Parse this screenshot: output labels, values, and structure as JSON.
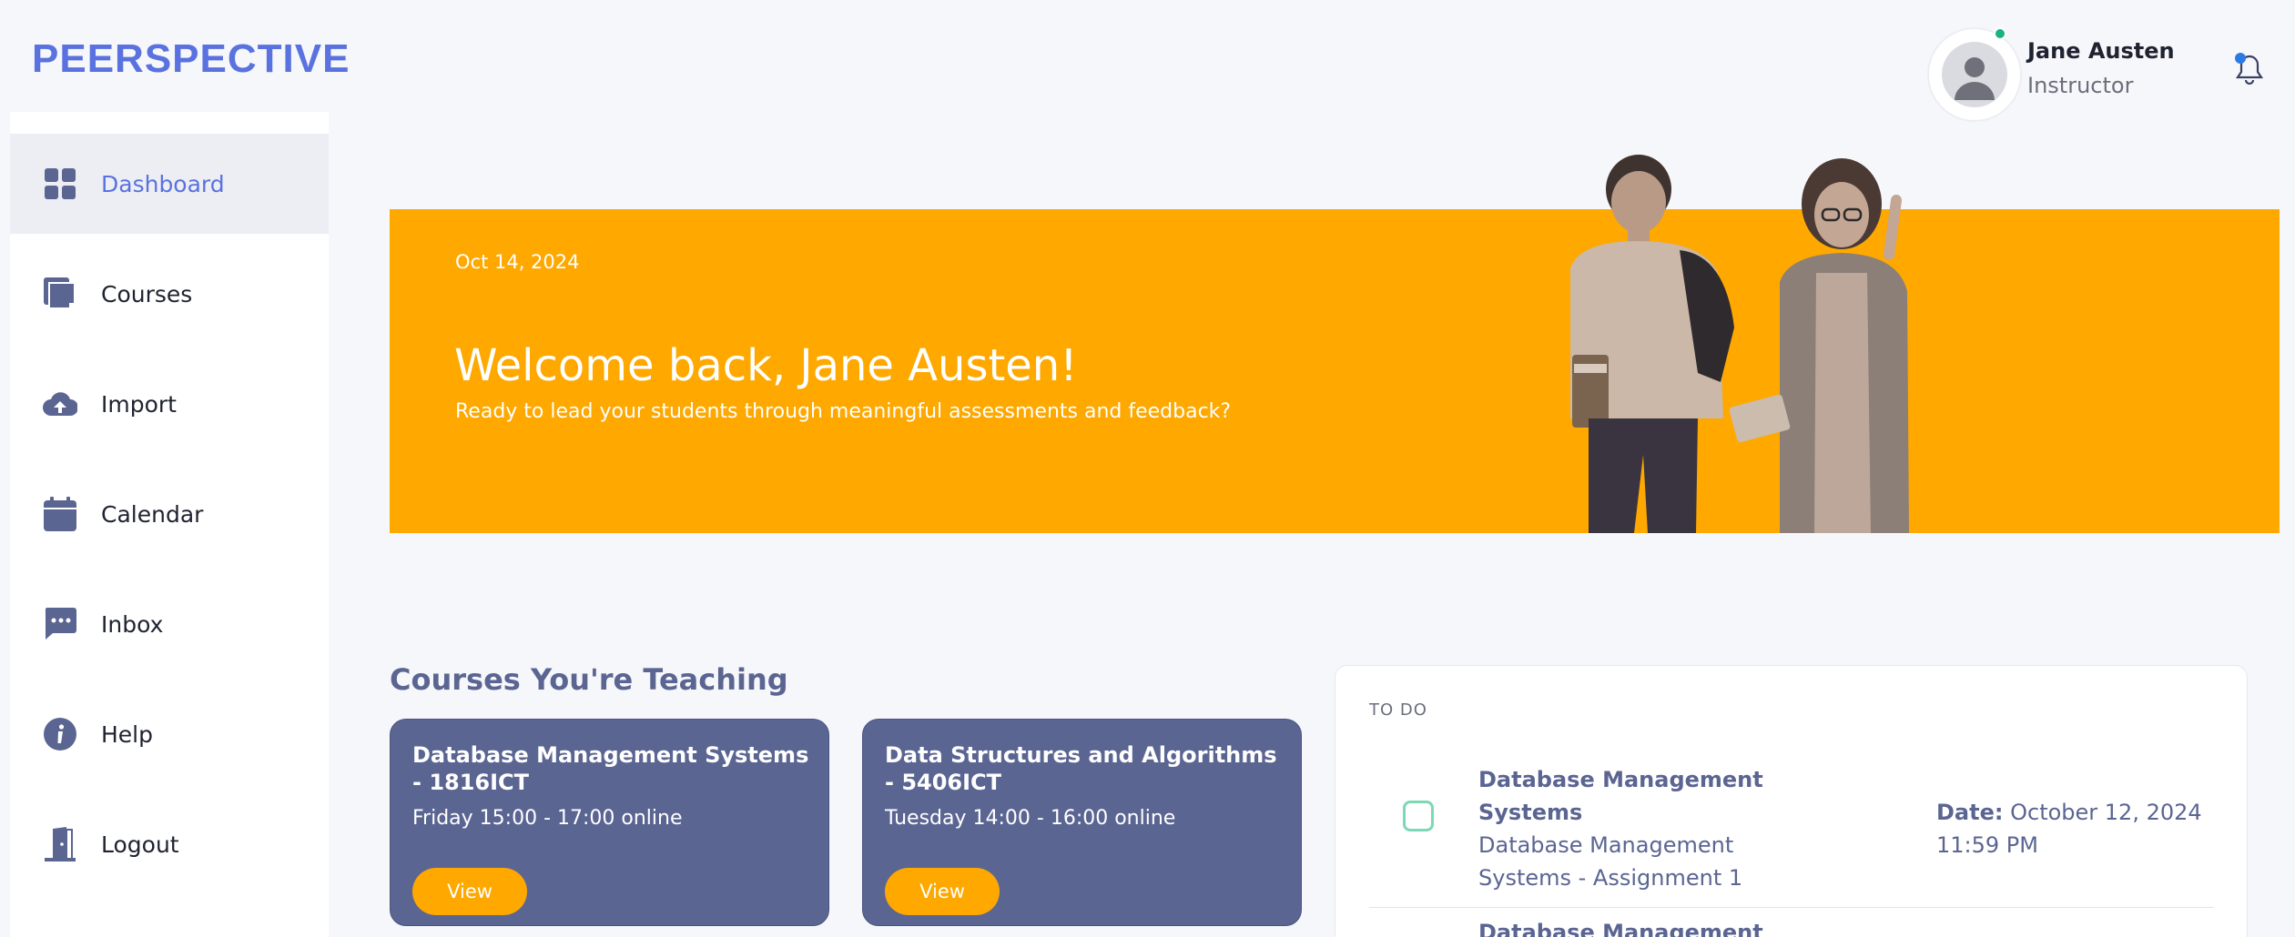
{
  "brand": {
    "name": "PEERSPECTIVE",
    "color": "#5a72e0"
  },
  "sidebar": {
    "items": [
      {
        "label": "Dashboard",
        "icon": "dashboard-icon",
        "active": true
      },
      {
        "label": "Courses",
        "icon": "courses-icon"
      },
      {
        "label": "Import",
        "icon": "cloud-upload-icon"
      },
      {
        "label": "Calendar",
        "icon": "calendar-icon"
      },
      {
        "label": "Inbox",
        "icon": "chat-icon"
      },
      {
        "label": "Help",
        "icon": "info-icon"
      },
      {
        "label": "Logout",
        "icon": "logout-door-icon"
      }
    ]
  },
  "user": {
    "name": "Jane Austen",
    "role": "Instructor",
    "status_color": "#19b37d"
  },
  "banner": {
    "date": "Oct 14, 2024",
    "title": "Welcome back, Jane Austen!",
    "subtitle": "Ready to lead your students through meaningful assessments and feedback?",
    "background": "#fea800"
  },
  "courses": {
    "heading": "Courses You're Teaching",
    "cards": [
      {
        "name": "Database Management Systems - 1816ICT",
        "schedule": "Friday 15:00 - 17:00 online",
        "button": "View"
      },
      {
        "name": "Data Structures and Algorithms - 5406ICT",
        "schedule": "Tuesday 14:00 - 16:00 online",
        "button": "View"
      }
    ],
    "card_color": "#5b6592",
    "button_color": "#fea800"
  },
  "todo": {
    "heading": "TO DO",
    "items": [
      {
        "title": "Database Management Systems",
        "description": "Database Management Systems - Assignment 1",
        "date_label": "Date:",
        "date_value": "October 12, 2024 11:59 PM"
      },
      {
        "title": "Database Management"
      }
    ]
  }
}
